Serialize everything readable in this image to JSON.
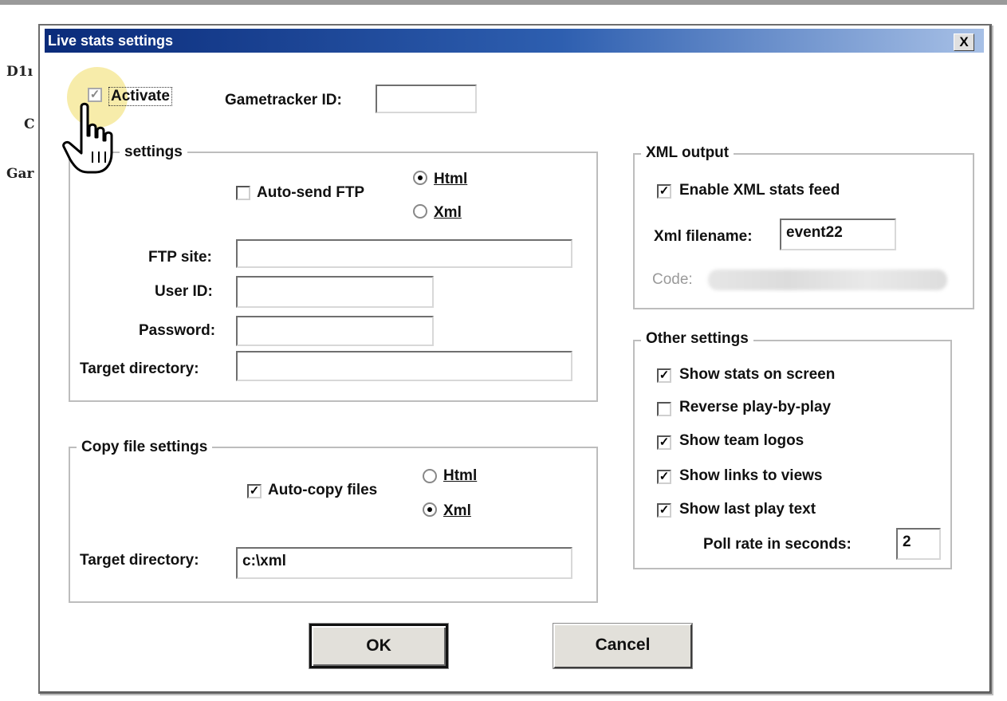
{
  "background": {
    "labels": [
      "D1ı",
      "C",
      "Gar"
    ]
  },
  "dialog": {
    "title": "Live stats settings",
    "close_label": "X",
    "activate": {
      "label": "Activate",
      "checked": true
    },
    "gametracker": {
      "label": "Gametracker ID:",
      "value": ""
    },
    "ftp_group": {
      "legend": "settings",
      "auto_send": {
        "label": "Auto-send FTP",
        "checked": false
      },
      "format": {
        "html_label": "Html",
        "xml_label": "Xml",
        "selected": "Html"
      },
      "ftp_site": {
        "label": "FTP site:",
        "value": ""
      },
      "user_id": {
        "label": "User ID:",
        "value": ""
      },
      "password": {
        "label": "Password:",
        "value": ""
      },
      "target_dir": {
        "label": "Target directory:",
        "value": ""
      }
    },
    "copy_group": {
      "legend": "Copy file settings",
      "auto_copy": {
        "label": "Auto-copy files",
        "checked": true
      },
      "format": {
        "html_label": "Html",
        "xml_label": "Xml",
        "selected": "Xml"
      },
      "target_dir": {
        "label": "Target directory:",
        "value": "c:\\xml"
      }
    },
    "xml_group": {
      "legend": "XML output",
      "enable_feed": {
        "label": "Enable XML stats feed",
        "checked": true
      },
      "filename": {
        "label": "Xml filename:",
        "value": "event22"
      },
      "code": {
        "label": "Code:"
      }
    },
    "other_group": {
      "legend": "Other settings",
      "options": [
        {
          "label": "Show stats on screen",
          "checked": true
        },
        {
          "label": "Reverse play-by-play",
          "checked": false
        },
        {
          "label": "Show team logos",
          "checked": true
        },
        {
          "label": "Show links to views",
          "checked": true
        },
        {
          "label": "Show last play text",
          "checked": true
        }
      ],
      "poll_rate": {
        "label": "Poll rate in seconds:",
        "value": "2"
      }
    },
    "buttons": {
      "ok": "OK",
      "cancel": "Cancel"
    }
  },
  "icons": {
    "check": "checkmark-icon",
    "cursor": "hand-pointer-icon",
    "close": "close-icon"
  }
}
